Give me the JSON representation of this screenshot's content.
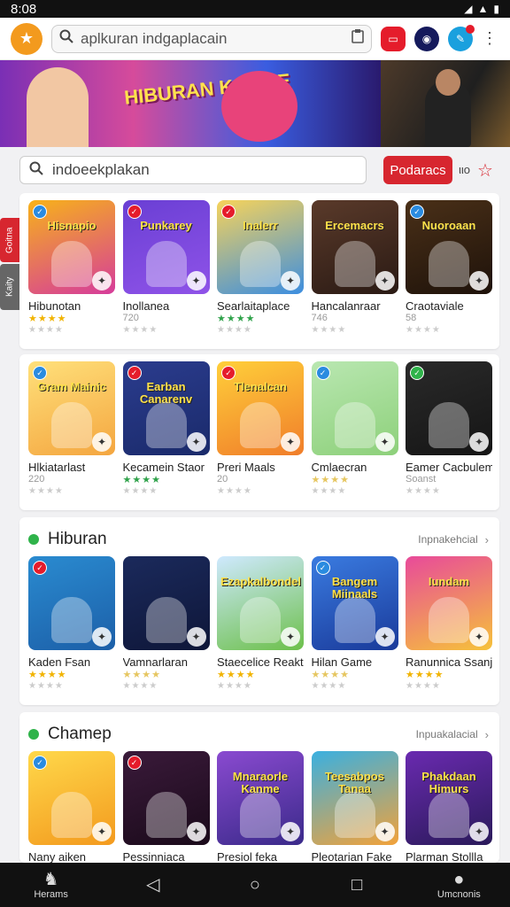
{
  "status": {
    "time": "8:08"
  },
  "topbar": {
    "search_text": "aplkuran indgaplacain"
  },
  "banner": {
    "title": "HIBURAN KANME"
  },
  "search2": {
    "text": "indoeekplakan",
    "button": "Podaracs",
    "io": "ιιο"
  },
  "side_tabs": [
    "Goitna",
    "Kaity"
  ],
  "row1": [
    {
      "title": "Hibunotan",
      "art": "Hisnapio",
      "stars": "★★★★",
      "star_style": "gold",
      "sub": "",
      "colors": [
        "#f7b21a",
        "#d63c9b"
      ],
      "badge": "blue"
    },
    {
      "title": "Inollanea",
      "art": "Punkarey",
      "stars": "",
      "star_style": "gold",
      "sub": "720",
      "colors": [
        "#6a3fd4",
        "#8f53e8"
      ],
      "badge": "red"
    },
    {
      "title": "Searlaitaplace",
      "art": "Inalerr",
      "stars": "★★★★",
      "star_style": "green",
      "sub": "",
      "colors": [
        "#f7d35a",
        "#3c8ee0"
      ],
      "badge": "red"
    },
    {
      "title": "Hancalanraar",
      "art": "Ercemacrs",
      "stars": "",
      "star_style": "gold",
      "sub": "746",
      "colors": [
        "#5a3a2a",
        "#2a1a14"
      ],
      "badge": "none"
    },
    {
      "title": "Craotaviale",
      "art": "Nuoroaan",
      "stars": "",
      "star_style": "gold",
      "sub": "58",
      "colors": [
        "#4a3018",
        "#1e120a"
      ],
      "badge": "blue"
    }
  ],
  "row2": [
    {
      "title": "Hlkiatarlast",
      "art": "Gram Mainic",
      "stars": "",
      "star_style": "gold",
      "sub": "220",
      "colors": [
        "#ffe07a",
        "#f4a640"
      ],
      "badge": "blue"
    },
    {
      "title": "Kecamein Staor",
      "art": "Earban Canarenv",
      "stars": "★★★★",
      "star_style": "green",
      "sub": "",
      "colors": [
        "#2b3c8e",
        "#1a2a6a"
      ],
      "badge": "red"
    },
    {
      "title": "Preri Maals",
      "art": "Tlenalcan",
      "stars": "",
      "star_style": "gold",
      "sub": "20",
      "colors": [
        "#ffcf3a",
        "#f07d2a"
      ],
      "badge": "red"
    },
    {
      "title": "Cmlaecran",
      "art": "",
      "stars": "★★★★",
      "star_style": "pale",
      "sub": "",
      "colors": [
        "#b9e7b1",
        "#8dd07a"
      ],
      "badge": "blue"
    },
    {
      "title": "Eamer Cacbulem",
      "art": "",
      "stars": "",
      "star_style": "gold",
      "sub": "Soanst",
      "colors": [
        "#2a2a2a",
        "#151515"
      ],
      "badge": "green"
    }
  ],
  "section1": {
    "title": "Hiburan",
    "more": "Inpnakehcial",
    "apps": [
      {
        "title": "Kaden Fsan",
        "art": "",
        "stars": "★★★★",
        "star_style": "gold",
        "colors": [
          "#2a8bd0",
          "#1c5fa8"
        ],
        "badge": "red"
      },
      {
        "title": "Vamnarlaran",
        "art": "",
        "stars": "★★★★",
        "star_style": "pale",
        "colors": [
          "#1b2a5c",
          "#0e1638"
        ],
        "badge": "none"
      },
      {
        "title": "Staecelice Reakt",
        "art": "Ezapkalbondel",
        "stars": "★★★★",
        "star_style": "gold",
        "colors": [
          "#cfe9ff",
          "#6cc04a"
        ],
        "badge": "none"
      },
      {
        "title": "Hilan Game",
        "art": "Bangem Miinaals",
        "stars": "★★★★",
        "star_style": "pale",
        "colors": [
          "#3a7be0",
          "#1a3a9a"
        ],
        "badge": "blue"
      },
      {
        "title": "Ranunnica Ssanj",
        "art": "Iundam",
        "stars": "★★★★",
        "star_style": "gold",
        "colors": [
          "#e84a9a",
          "#f6c23a"
        ],
        "badge": "none"
      }
    ]
  },
  "section2": {
    "title": "Chamep",
    "more": "Inpuakalacial",
    "apps": [
      {
        "title": "Nany aiken",
        "art": "",
        "colors": [
          "#ffd84a",
          "#f39a1e"
        ],
        "badge": "blue"
      },
      {
        "title": "Pessinniaca",
        "art": "",
        "colors": [
          "#3a1a3a",
          "#1a0a1a"
        ],
        "badge": "red"
      },
      {
        "title": "Presiol feka",
        "art": "Mnaraorle Kanme",
        "colors": [
          "#8a4ad0",
          "#3a2a8a"
        ],
        "badge": "none"
      },
      {
        "title": "Pleotarian Fake",
        "art": "Teesabpos Tanaa",
        "colors": [
          "#3ab0e0",
          "#f2a23a"
        ],
        "badge": "none"
      },
      {
        "title": "Plarman Stollla",
        "art": "Phakdaan Himurs",
        "colors": [
          "#6a2ab0",
          "#2a1a5a"
        ],
        "badge": "none"
      }
    ]
  },
  "navbar": {
    "left_label": "Herams",
    "right_label": "Umcnonis"
  }
}
